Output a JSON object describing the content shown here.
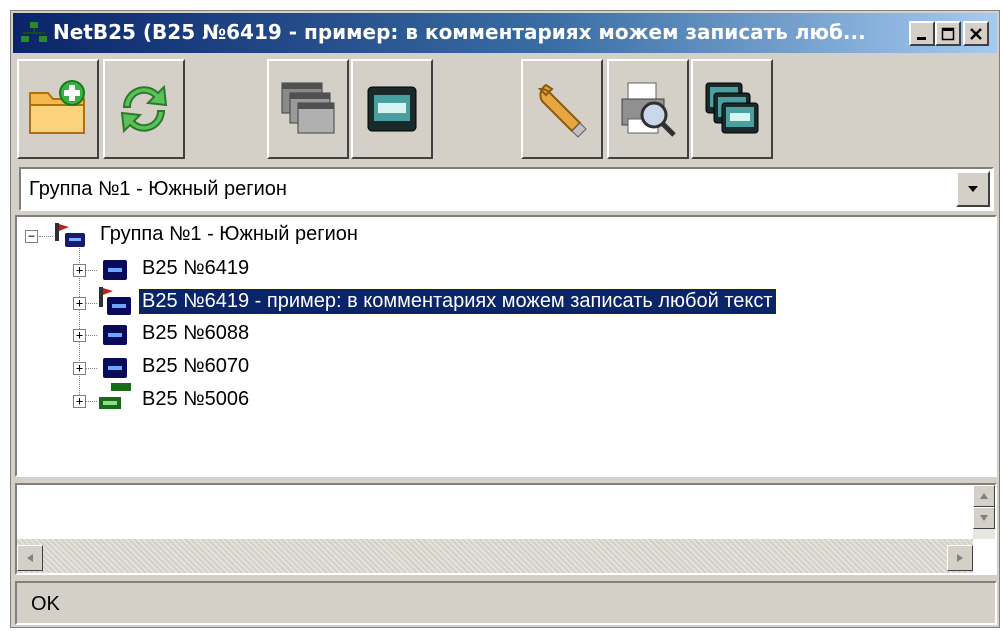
{
  "window": {
    "title": "NetB25 (B25 №6419 - пример: в комментариях можем записать люб...",
    "controls": {
      "minimize": "_",
      "maximize": "□",
      "close": "×"
    }
  },
  "toolbar": {
    "buttons": [
      {
        "name": "add-folder-icon"
      },
      {
        "name": "refresh-icon"
      },
      {
        "name": "windows-icon"
      },
      {
        "name": "device-screen-icon"
      },
      {
        "name": "wrench-icon"
      },
      {
        "name": "printer-icon"
      },
      {
        "name": "multi-screen-icon"
      }
    ]
  },
  "group_select": {
    "value": "Группа №1 -  Южный регион"
  },
  "tree": {
    "root": {
      "label": "Группа №1 -  Южный регион",
      "expander": "−"
    },
    "items": [
      {
        "label": "B25 №6419",
        "expander": "+",
        "icon": "device-blue-icon",
        "selected": false
      },
      {
        "label": "B25 №6419 - пример: в комментариях можем записать любой текст",
        "expander": "+",
        "icon": "device-tagged-icon",
        "selected": true
      },
      {
        "label": "B25 №6088",
        "expander": "+",
        "icon": "device-blue-icon",
        "selected": false
      },
      {
        "label": "B25 №6070",
        "expander": "+",
        "icon": "device-blue-icon",
        "selected": false
      },
      {
        "label": "B25 №5006",
        "expander": "+",
        "icon": "device-green-icon",
        "selected": false
      }
    ]
  },
  "status": {
    "text": "OK"
  },
  "colors": {
    "title_start": "#0a246a",
    "title_end": "#a6caf0",
    "selection": "#0a246a",
    "face": "#d4d0c8"
  }
}
